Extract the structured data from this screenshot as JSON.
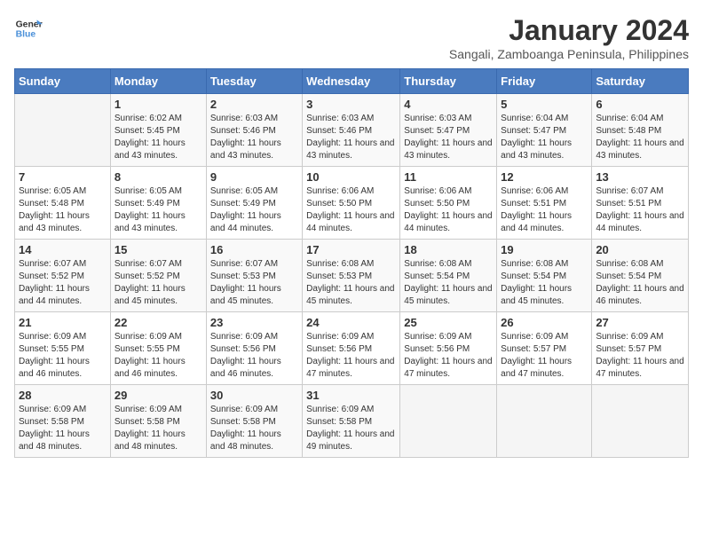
{
  "logo": {
    "text_general": "General",
    "text_blue": "Blue"
  },
  "header": {
    "month": "January 2024",
    "location": "Sangali, Zamboanga Peninsula, Philippines"
  },
  "weekdays": [
    "Sunday",
    "Monday",
    "Tuesday",
    "Wednesday",
    "Thursday",
    "Friday",
    "Saturday"
  ],
  "weeks": [
    [
      {
        "day": "",
        "sunrise": "",
        "sunset": "",
        "daylight": ""
      },
      {
        "day": "1",
        "sunrise": "Sunrise: 6:02 AM",
        "sunset": "Sunset: 5:45 PM",
        "daylight": "Daylight: 11 hours and 43 minutes."
      },
      {
        "day": "2",
        "sunrise": "Sunrise: 6:03 AM",
        "sunset": "Sunset: 5:46 PM",
        "daylight": "Daylight: 11 hours and 43 minutes."
      },
      {
        "day": "3",
        "sunrise": "Sunrise: 6:03 AM",
        "sunset": "Sunset: 5:46 PM",
        "daylight": "Daylight: 11 hours and 43 minutes."
      },
      {
        "day": "4",
        "sunrise": "Sunrise: 6:03 AM",
        "sunset": "Sunset: 5:47 PM",
        "daylight": "Daylight: 11 hours and 43 minutes."
      },
      {
        "day": "5",
        "sunrise": "Sunrise: 6:04 AM",
        "sunset": "Sunset: 5:47 PM",
        "daylight": "Daylight: 11 hours and 43 minutes."
      },
      {
        "day": "6",
        "sunrise": "Sunrise: 6:04 AM",
        "sunset": "Sunset: 5:48 PM",
        "daylight": "Daylight: 11 hours and 43 minutes."
      }
    ],
    [
      {
        "day": "7",
        "sunrise": "Sunrise: 6:05 AM",
        "sunset": "Sunset: 5:48 PM",
        "daylight": "Daylight: 11 hours and 43 minutes."
      },
      {
        "day": "8",
        "sunrise": "Sunrise: 6:05 AM",
        "sunset": "Sunset: 5:49 PM",
        "daylight": "Daylight: 11 hours and 43 minutes."
      },
      {
        "day": "9",
        "sunrise": "Sunrise: 6:05 AM",
        "sunset": "Sunset: 5:49 PM",
        "daylight": "Daylight: 11 hours and 44 minutes."
      },
      {
        "day": "10",
        "sunrise": "Sunrise: 6:06 AM",
        "sunset": "Sunset: 5:50 PM",
        "daylight": "Daylight: 11 hours and 44 minutes."
      },
      {
        "day": "11",
        "sunrise": "Sunrise: 6:06 AM",
        "sunset": "Sunset: 5:50 PM",
        "daylight": "Daylight: 11 hours and 44 minutes."
      },
      {
        "day": "12",
        "sunrise": "Sunrise: 6:06 AM",
        "sunset": "Sunset: 5:51 PM",
        "daylight": "Daylight: 11 hours and 44 minutes."
      },
      {
        "day": "13",
        "sunrise": "Sunrise: 6:07 AM",
        "sunset": "Sunset: 5:51 PM",
        "daylight": "Daylight: 11 hours and 44 minutes."
      }
    ],
    [
      {
        "day": "14",
        "sunrise": "Sunrise: 6:07 AM",
        "sunset": "Sunset: 5:52 PM",
        "daylight": "Daylight: 11 hours and 44 minutes."
      },
      {
        "day": "15",
        "sunrise": "Sunrise: 6:07 AM",
        "sunset": "Sunset: 5:52 PM",
        "daylight": "Daylight: 11 hours and 45 minutes."
      },
      {
        "day": "16",
        "sunrise": "Sunrise: 6:07 AM",
        "sunset": "Sunset: 5:53 PM",
        "daylight": "Daylight: 11 hours and 45 minutes."
      },
      {
        "day": "17",
        "sunrise": "Sunrise: 6:08 AM",
        "sunset": "Sunset: 5:53 PM",
        "daylight": "Daylight: 11 hours and 45 minutes."
      },
      {
        "day": "18",
        "sunrise": "Sunrise: 6:08 AM",
        "sunset": "Sunset: 5:54 PM",
        "daylight": "Daylight: 11 hours and 45 minutes."
      },
      {
        "day": "19",
        "sunrise": "Sunrise: 6:08 AM",
        "sunset": "Sunset: 5:54 PM",
        "daylight": "Daylight: 11 hours and 45 minutes."
      },
      {
        "day": "20",
        "sunrise": "Sunrise: 6:08 AM",
        "sunset": "Sunset: 5:54 PM",
        "daylight": "Daylight: 11 hours and 46 minutes."
      }
    ],
    [
      {
        "day": "21",
        "sunrise": "Sunrise: 6:09 AM",
        "sunset": "Sunset: 5:55 PM",
        "daylight": "Daylight: 11 hours and 46 minutes."
      },
      {
        "day": "22",
        "sunrise": "Sunrise: 6:09 AM",
        "sunset": "Sunset: 5:55 PM",
        "daylight": "Daylight: 11 hours and 46 minutes."
      },
      {
        "day": "23",
        "sunrise": "Sunrise: 6:09 AM",
        "sunset": "Sunset: 5:56 PM",
        "daylight": "Daylight: 11 hours and 46 minutes."
      },
      {
        "day": "24",
        "sunrise": "Sunrise: 6:09 AM",
        "sunset": "Sunset: 5:56 PM",
        "daylight": "Daylight: 11 hours and 47 minutes."
      },
      {
        "day": "25",
        "sunrise": "Sunrise: 6:09 AM",
        "sunset": "Sunset: 5:56 PM",
        "daylight": "Daylight: 11 hours and 47 minutes."
      },
      {
        "day": "26",
        "sunrise": "Sunrise: 6:09 AM",
        "sunset": "Sunset: 5:57 PM",
        "daylight": "Daylight: 11 hours and 47 minutes."
      },
      {
        "day": "27",
        "sunrise": "Sunrise: 6:09 AM",
        "sunset": "Sunset: 5:57 PM",
        "daylight": "Daylight: 11 hours and 47 minutes."
      }
    ],
    [
      {
        "day": "28",
        "sunrise": "Sunrise: 6:09 AM",
        "sunset": "Sunset: 5:58 PM",
        "daylight": "Daylight: 11 hours and 48 minutes."
      },
      {
        "day": "29",
        "sunrise": "Sunrise: 6:09 AM",
        "sunset": "Sunset: 5:58 PM",
        "daylight": "Daylight: 11 hours and 48 minutes."
      },
      {
        "day": "30",
        "sunrise": "Sunrise: 6:09 AM",
        "sunset": "Sunset: 5:58 PM",
        "daylight": "Daylight: 11 hours and 48 minutes."
      },
      {
        "day": "31",
        "sunrise": "Sunrise: 6:09 AM",
        "sunset": "Sunset: 5:58 PM",
        "daylight": "Daylight: 11 hours and 49 minutes."
      },
      {
        "day": "",
        "sunrise": "",
        "sunset": "",
        "daylight": ""
      },
      {
        "day": "",
        "sunrise": "",
        "sunset": "",
        "daylight": ""
      },
      {
        "day": "",
        "sunrise": "",
        "sunset": "",
        "daylight": ""
      }
    ]
  ]
}
